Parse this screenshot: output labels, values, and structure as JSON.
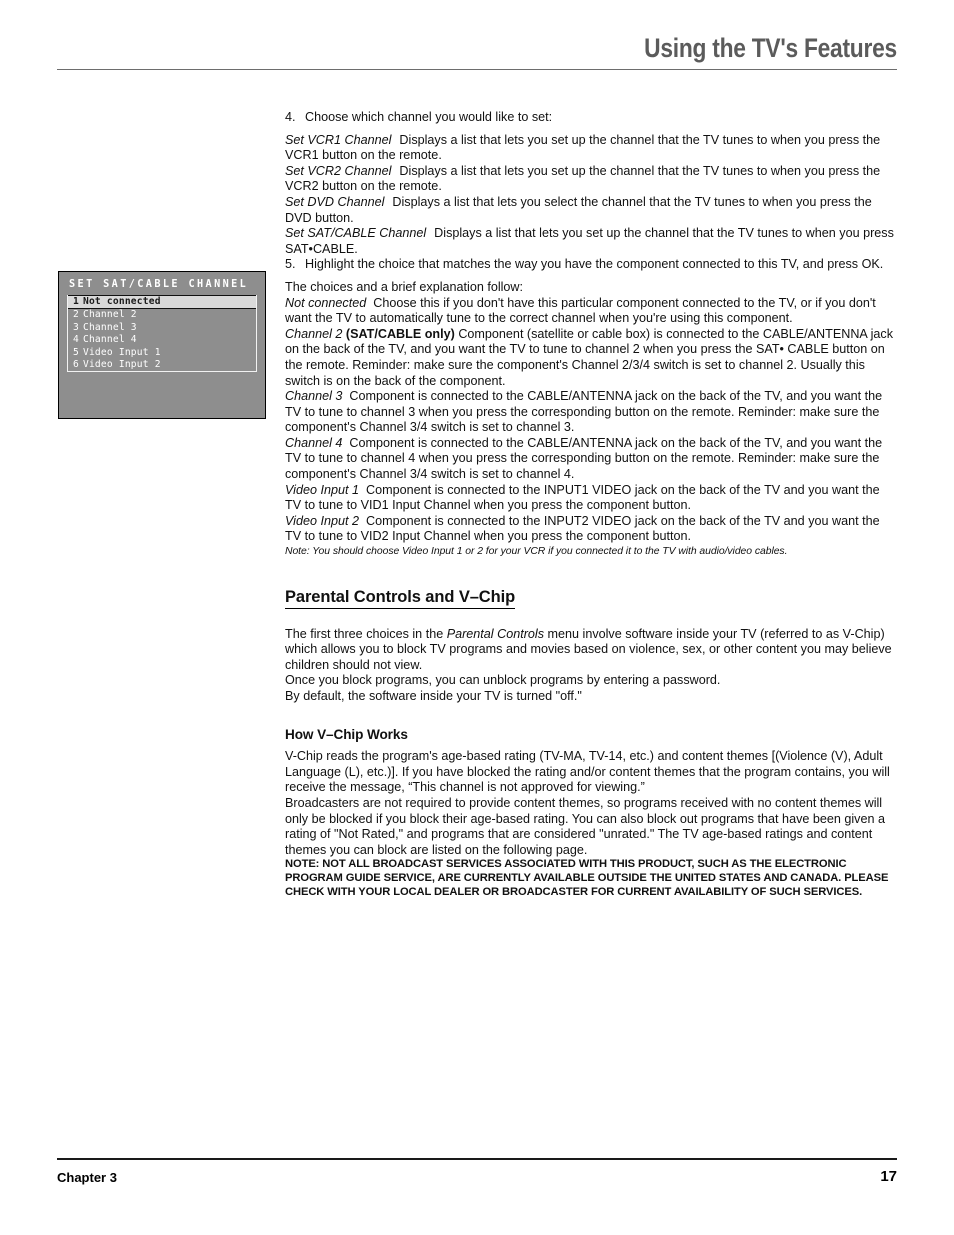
{
  "header": {
    "title": "Using the TV's Features"
  },
  "tv_menu": {
    "title": "SET SAT/CABLE CHANNEL",
    "items": [
      {
        "num": "1",
        "label": "Not connected",
        "selected": true
      },
      {
        "num": "2",
        "label": "Channel 2",
        "selected": false
      },
      {
        "num": "3",
        "label": "Channel 3",
        "selected": false
      },
      {
        "num": "4",
        "label": "Channel 4",
        "selected": false
      },
      {
        "num": "5",
        "label": "Video Input 1",
        "selected": false
      },
      {
        "num": "6",
        "label": "Video Input 2",
        "selected": false
      }
    ],
    "colors": {
      "background": "#8e8e8e",
      "border": "#000000",
      "selected_background": "#d9d9d9",
      "text": "#ffffff"
    }
  },
  "content": {
    "step4": {
      "num": "4.",
      "text": "Choose which channel you would like to set:"
    },
    "definitions": [
      {
        "lead": "Set VCR1 Channel",
        "body": "Displays a list that lets you set up the channel that the TV tunes to when you press the VCR1 button on the remote."
      },
      {
        "lead": "Set VCR2 Channel",
        "body": "Displays a list that lets you set up the channel that the TV tunes to when you press the VCR2 button on the remote."
      },
      {
        "lead": "Set DVD Channel",
        "body": "Displays a list that lets you select the channel that the TV tunes to when you press the DVD button."
      },
      {
        "lead": "Set SAT/CABLE Channel",
        "body": "Displays a list that lets you set up the channel that the TV tunes to when you press SAT•CABLE."
      }
    ],
    "step5": {
      "num": "5.",
      "text": "Highlight the choice that matches the way you have the component connected to this TV, and press OK."
    },
    "choices_lead_in": "The choices and a brief explanation follow:",
    "choices": [
      {
        "lead": "Not connected",
        "strong": "",
        "body": "Choose this if you don't have this particular component connected to the TV, or if you don't want the TV to automatically tune to the correct channel when you're using this component."
      },
      {
        "lead": "Channel 2",
        "strong": "(SAT/CABLE only)",
        "body": "Component (satellite or cable box) is connected to the CABLE/ANTENNA jack on the back of the TV, and you want the TV to tune to channel 2 when you press the SAT• CABLE button on the remote. Reminder: make sure the component's Channel 2/3/4 switch is set to channel 2. Usually this switch is on the back of the component."
      },
      {
        "lead": "Channel 3",
        "strong": "",
        "body": "Component is connected to the CABLE/ANTENNA jack on the back of the TV, and you want the TV to tune to channel 3 when you press the corresponding button on the remote. Reminder: make sure the component's Channel 3/4 switch is set to channel 3."
      },
      {
        "lead": "Channel 4",
        "strong": "",
        "body": "Component is connected to the CABLE/ANTENNA jack on the back of the TV, and you want the TV to tune to channel 4 when you press the corresponding button on the remote. Reminder: make sure the component's Channel 3/4 switch is set to channel 4."
      },
      {
        "lead": "Video Input 1",
        "strong": "",
        "body": "Component is connected to the INPUT1 VIDEO jack on the back of the TV and you want the TV to tune to VID1 Input Channel when you press the component button."
      },
      {
        "lead": "Video Input 2",
        "strong": "",
        "body": "Component is connected to the INPUT2 VIDEO jack on the back of the TV and you want the TV to tune to VID2 Input Channel when you press the component button."
      }
    ],
    "video_input_note": "Note: You should choose Video Input 1 or 2  for your VCR if you connected it to the TV with audio/video cables.",
    "parental_controls": {
      "heading": "Parental Controls and V–Chip",
      "para1_a": "The first three choices in the ",
      "para1_italic": "Parental Controls",
      "para1_b": " menu involve software inside your TV (referred to as V-Chip) which allows you to block TV programs and movies based on violence, sex, or other content you may believe children should not view.",
      "para2": "Once you block programs, you can unblock programs by entering a password.",
      "para3": "By default, the software inside your TV is turned \"off.\""
    },
    "how_vchip": {
      "heading": "How V–Chip Works",
      "para1": "V-Chip reads the program's age-based rating (TV-MA, TV-14, etc.) and content themes [(Violence (V), Adult Language (L), etc.)]. If you have blocked the rating and/or content themes that the program contains, you will receive the message, “This channel is not approved for viewing.”",
      "para2": "Broadcasters are not required to provide content themes, so programs received with no content themes will only be blocked if you block their age-based rating. You can also block out programs that have been given a rating of \"Not Rated,\" and programs that are considered \"unrated.\" The TV age-based ratings and content themes you can block are listed on the following page.",
      "notice": "NOTE: NOT ALL BROADCAST SERVICES ASSOCIATED WITH THIS PRODUCT, SUCH AS THE ELECTRONIC PROGRAM GUIDE SERVICE, ARE CURRENTLY AVAILABLE OUTSIDE THE UNITED STATES AND CANADA. PLEASE CHECK WITH YOUR LOCAL DEALER OR BROADCASTER FOR CURRENT AVAILABILITY OF SUCH SERVICES."
    }
  },
  "footer": {
    "chapter": "Chapter 3",
    "page_number": "17"
  }
}
